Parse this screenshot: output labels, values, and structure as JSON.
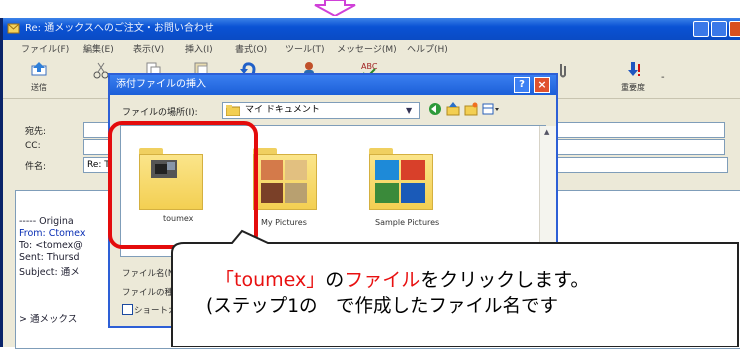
{
  "colors": {
    "highlight": "#e40c0c",
    "arrow": "#d040d8",
    "title_blue": "#0a52d4"
  },
  "main_window": {
    "title": "Re: 通メックスへのご注文・お問い合わせ",
    "menu": [
      "ファイル(F)",
      "編集(E)",
      "表示(V)",
      "挿入(I)",
      "書式(O)",
      "ツール(T)",
      "メッセージ(M)",
      "ヘルプ(H)"
    ],
    "toolbar": [
      {
        "label": "送信",
        "icon": "send-icon"
      },
      {
        "label": "",
        "icon": "cut-icon"
      },
      {
        "label": "",
        "icon": "copy-icon"
      },
      {
        "label": "",
        "icon": "paste-icon"
      },
      {
        "label": "",
        "icon": "undo-icon"
      },
      {
        "label": "",
        "icon": "check-names-icon"
      },
      {
        "label": "",
        "icon": "spelling-icon"
      },
      {
        "label": "",
        "icon": "attach-icon"
      },
      {
        "label": "重要度",
        "icon": "priority-icon"
      }
    ],
    "fields": {
      "to": "宛先:",
      "cc": "CC:",
      "subject": "件名:",
      "subject_value": "Re: Th"
    },
    "body": {
      "original": "----- Origina",
      "from": "From: Ctomex",
      "to": "To: <tomex@",
      "sent": "Sent: Thursd",
      "subject": "Subject: 通メ",
      "quote": "> 通メックス"
    }
  },
  "dialog": {
    "title": "添付ファイルの挿入",
    "help": "?",
    "close": "×",
    "lookin_label": "ファイルの場所(I):",
    "lookin_value": "マイ ドキュメント",
    "files": [
      {
        "name": "toumex"
      },
      {
        "name": "My Pictures"
      },
      {
        "name": "Sample Pictures"
      }
    ],
    "filename_label": "ファイル名(N):",
    "filetype_label": "ファイルの種類(T):",
    "shortcut_label": "ショートカット"
  },
  "callout": {
    "line1_q": "「toumex」",
    "line1_mid": "の",
    "line1_file": "ファイル",
    "line1_tail": "をクリックします。",
    "line2": "(ステップ1の　で作成したファイル名です"
  }
}
